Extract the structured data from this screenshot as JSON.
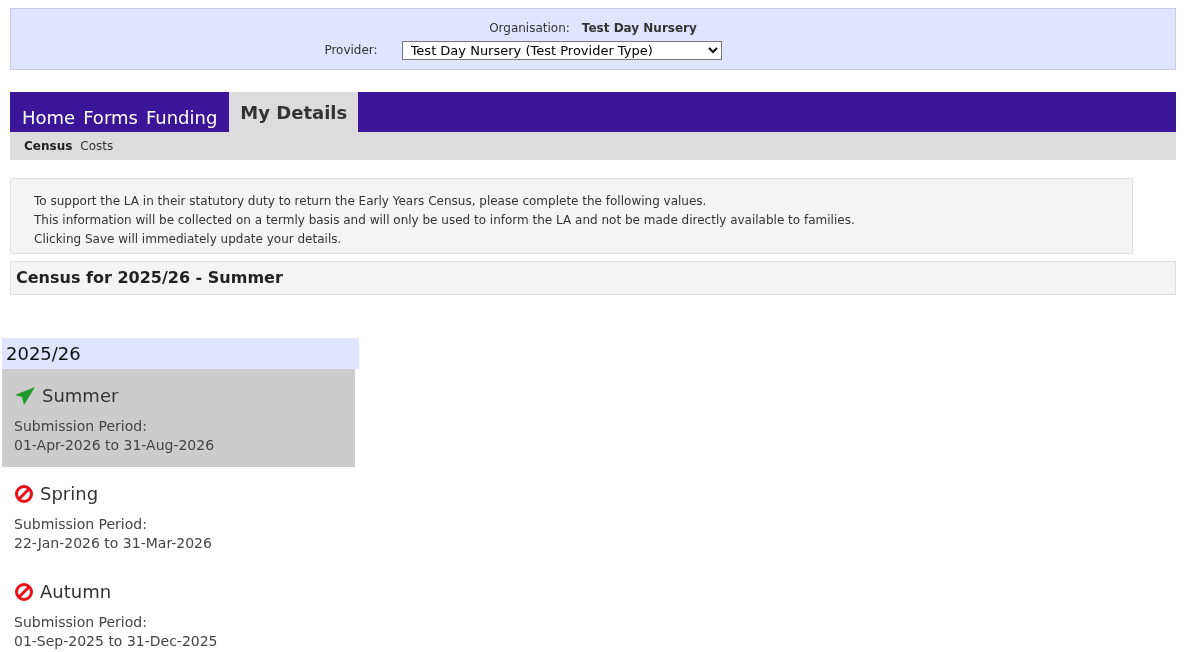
{
  "header": {
    "organisation_label": "Organisation:",
    "organisation": "Test Day Nursery",
    "provider_label": "Provider:",
    "provider": "Test Day Nursery (Test Provider Type)"
  },
  "tabs": [
    {
      "label": "Home",
      "selected": false
    },
    {
      "label": "Forms",
      "selected": false
    },
    {
      "label": "Funding",
      "selected": false
    },
    {
      "label": "My Details",
      "selected": true
    }
  ],
  "subtabs": [
    {
      "label": "Census",
      "selected": true
    },
    {
      "label": "Costs",
      "selected": false
    }
  ],
  "info": [
    "To support the LA in their statutory duty to return the Early Years Census, please complete the following values.",
    "This information will be collected on a termly basis and will only be used to inform the LA and not be made directly available to families.",
    "Clicking Save will immediately update your details."
  ],
  "heading": "Census for 2025/26 - Summer",
  "year": "2025/26",
  "terms": [
    {
      "name": "Summer",
      "kind": "open",
      "selected": true,
      "period_label": "Submission Period:",
      "period": "01-Apr-2026 to 31-Aug-2026"
    },
    {
      "name": "Spring",
      "kind": "closed",
      "selected": false,
      "period_label": "Submission Period:",
      "period": "22-Jan-2026 to 31-Mar-2026"
    },
    {
      "name": "Autumn",
      "kind": "closed",
      "selected": false,
      "period_label": "Submission Period:",
      "period": "01-Sep-2025 to 31-Dec-2025"
    }
  ]
}
